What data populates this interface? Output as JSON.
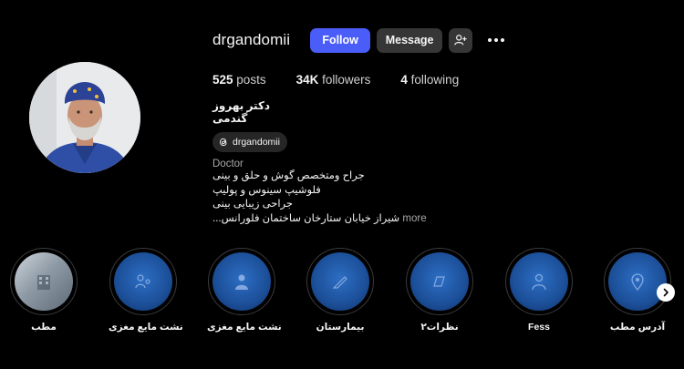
{
  "profile": {
    "username": "drgandomii",
    "follow_label": "Follow",
    "message_label": "Message",
    "add_user_icon": "add-user-icon",
    "more_icon": "more-options-icon",
    "stats": {
      "posts_count": "525",
      "posts_label": "posts",
      "followers_count": "34K",
      "followers_label": "followers",
      "following_count": "4",
      "following_label": "following"
    },
    "full_name": "دکتر بهروز گندمی",
    "threads_handle": "drgandomii",
    "category": "Doctor",
    "bio_lines": [
      "جراح ومتخصص گوش و حلق و بینی",
      "فلوشیپ سینوس و پولیپ",
      "جراحی زیبایی بینی",
      "شیراز خیابان ستارخان ساختمان فلورانس..."
    ],
    "more_label": "more"
  },
  "highlights": [
    {
      "label": "مطب",
      "icon": "clinic-photo"
    },
    {
      "label": "نشت مایع مغزی",
      "icon": "doctor-patient-icon"
    },
    {
      "label": "نشت مایع مغزی",
      "icon": "doctor-icon"
    },
    {
      "label": "بیمارستان",
      "icon": "scalpel-icon"
    },
    {
      "label": "نظرات۲",
      "icon": "chat-icon"
    },
    {
      "label": "Fess",
      "icon": "surgeon-icon"
    },
    {
      "label": "آدرس مطب",
      "icon": "location-pin-icon"
    }
  ],
  "colors": {
    "background": "#000000",
    "follow_button": "#4a5df9",
    "secondary_button": "#363636",
    "highlight_blue": "#1c4f98"
  }
}
